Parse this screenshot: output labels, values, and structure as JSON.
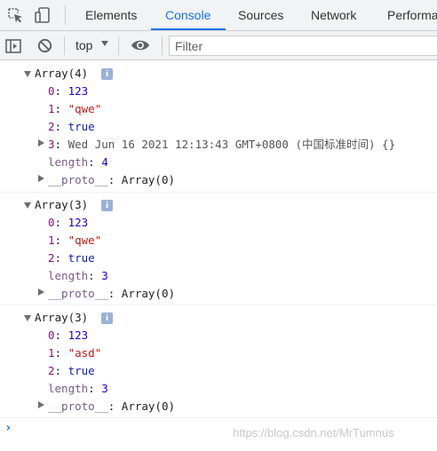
{
  "tabs": [
    {
      "label": "Elements"
    },
    {
      "label": "Console",
      "active": true
    },
    {
      "label": "Sources"
    },
    {
      "label": "Network"
    },
    {
      "label": "Performa"
    }
  ],
  "toolbar": {
    "context": "top",
    "filter_placeholder": "Filter"
  },
  "logs": [
    {
      "header": "Array(4)",
      "items": [
        {
          "index": "0",
          "value": "123",
          "type": "number"
        },
        {
          "index": "1",
          "value": "\"qwe\"",
          "type": "string"
        },
        {
          "index": "2",
          "value": "true",
          "type": "boolean"
        },
        {
          "index": "3",
          "value": "Wed Jun 16 2021 12:13:43 GMT+0800 (中国标准时间) {}",
          "type": "date"
        }
      ],
      "length": "4",
      "proto": "Array(0)"
    },
    {
      "header": "Array(3)",
      "items": [
        {
          "index": "0",
          "value": "123",
          "type": "number"
        },
        {
          "index": "1",
          "value": "\"qwe\"",
          "type": "string"
        },
        {
          "index": "2",
          "value": "true",
          "type": "boolean"
        }
      ],
      "length": "3",
      "proto": "Array(0)"
    },
    {
      "header": "Array(3)",
      "items": [
        {
          "index": "0",
          "value": "123",
          "type": "number"
        },
        {
          "index": "1",
          "value": "\"asd\"",
          "type": "string"
        },
        {
          "index": "2",
          "value": "true",
          "type": "boolean"
        }
      ],
      "length": "3",
      "proto": "Array(0)"
    }
  ],
  "labels": {
    "length_key": "length",
    "proto_key": "__proto__",
    "colon": ": ",
    "info": "i",
    "prompt": "›"
  },
  "watermark": "https://blog.csdn.net/MrTumnus",
  "colors": {
    "accent": "#1a73e8",
    "property_key": "#881280",
    "number": "#1c00cf",
    "string": "#c41a16",
    "boolean": "#0d22aa"
  }
}
